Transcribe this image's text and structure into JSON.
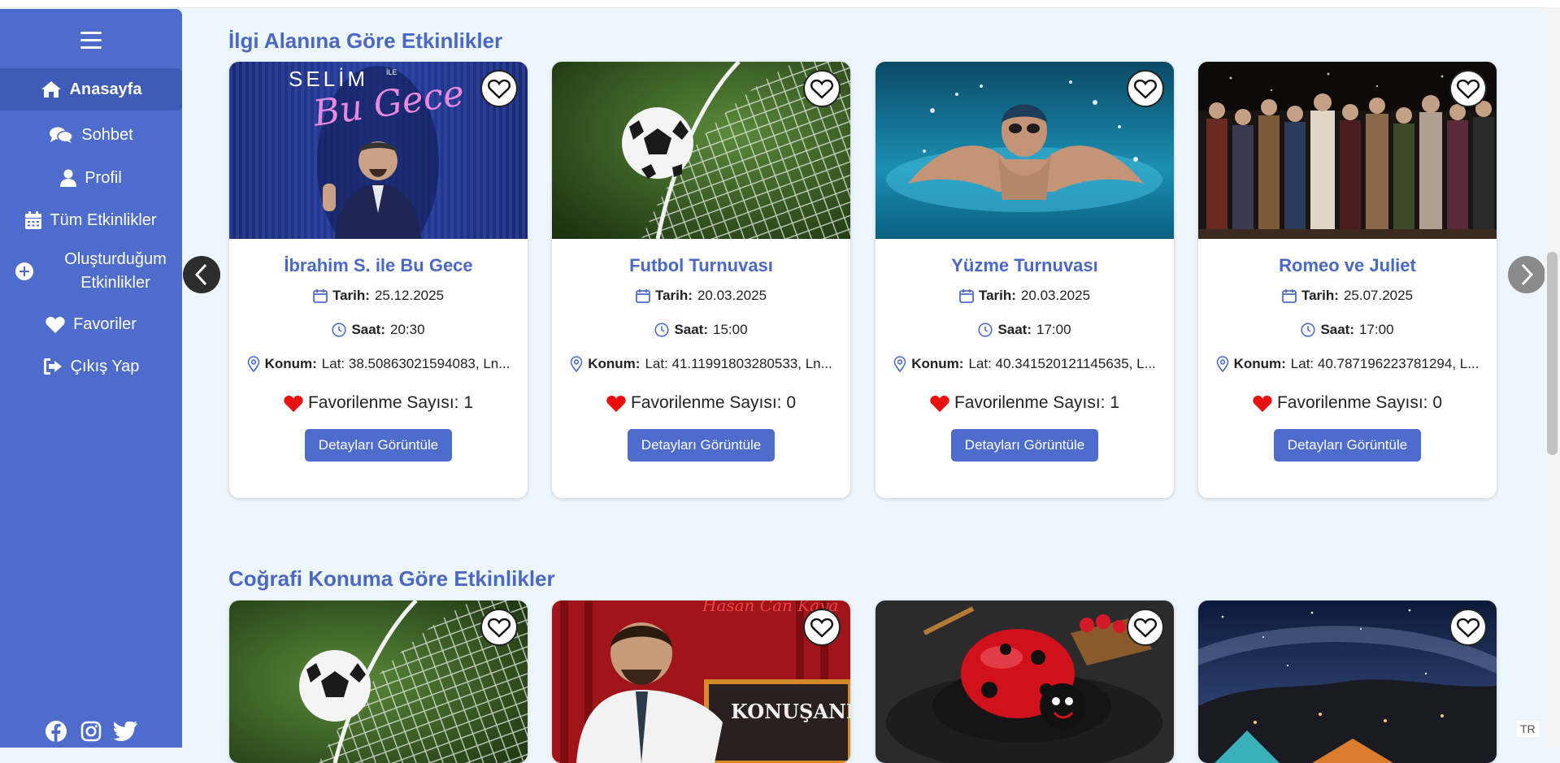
{
  "sidebar": {
    "items": [
      {
        "label": "Anasayfa"
      },
      {
        "label": "Sohbet"
      },
      {
        "label": "Profil"
      },
      {
        "label": "Tüm Etkinlikler"
      },
      {
        "label_line1": "Oluşturduğum",
        "label_line2": "Etkinlikler"
      },
      {
        "label": "Favoriler"
      },
      {
        "label": "Çıkış Yap"
      }
    ],
    "social": [
      "facebook-icon",
      "instagram-icon",
      "twitter-icon"
    ]
  },
  "sections": [
    {
      "title": "İlgi Alanına Göre Etkinlikler",
      "cards": [
        {
          "title": "İbrahim S. ile Bu Gece",
          "date_label": "Tarih:",
          "date": "25.12.2025",
          "time_label": "Saat:",
          "time": "20:30",
          "location_label": "Konum:",
          "location": "Lat: 38.50863021594083, Ln...",
          "fav_label": "Favorilenme Sayısı: 1",
          "button": "Detayları Görüntüle",
          "image_text_1": "SELİM",
          "image_text_2": "İLE",
          "image_text_3": "Bu Gece"
        },
        {
          "title": "Futbol Turnuvası",
          "date_label": "Tarih:",
          "date": "20.03.2025",
          "time_label": "Saat:",
          "time": "15:00",
          "location_label": "Konum:",
          "location": "Lat: 41.11991803280533, Ln...",
          "fav_label": "Favorilenme Sayısı: 0",
          "button": "Detayları Görüntüle"
        },
        {
          "title": "Yüzme Turnuvası",
          "date_label": "Tarih:",
          "date": "20.03.2025",
          "time_label": "Saat:",
          "time": "17:00",
          "location_label": "Konum:",
          "location": "Lat: 40.341520121145635, L...",
          "fav_label": "Favorilenme Sayısı: 1",
          "button": "Detayları Görüntüle"
        },
        {
          "title": "Romeo ve Juliet",
          "date_label": "Tarih:",
          "date": "25.07.2025",
          "time_label": "Saat:",
          "time": "17:00",
          "location_label": "Konum:",
          "location": "Lat: 40.787196223781294, L...",
          "fav_label": "Favorilenme Sayısı: 0",
          "button": "Detayları Görüntüle"
        }
      ]
    },
    {
      "title": "Coğrafi Konuma Göre Etkinlikler",
      "cards": [
        {
          "image": "football-goal"
        },
        {
          "image": "comedian",
          "image_text_1": "Hasan Can Kaya",
          "image_text_2": "KONUŞANLAR"
        },
        {
          "image": "ladybug-cake"
        },
        {
          "image": "camping-night"
        }
      ]
    }
  ],
  "lang": "TR",
  "colors": {
    "accent": "#4e6ccc",
    "title": "#4a68c4",
    "heart": "#e81010",
    "background": "#eef6fd"
  }
}
